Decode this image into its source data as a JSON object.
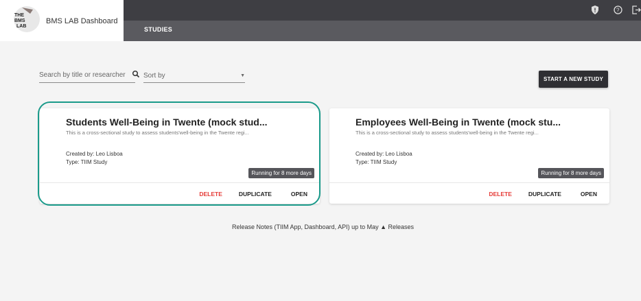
{
  "brand": {
    "title": "BMS LAB Dashboard",
    "logo_text": [
      "THE",
      "BMS",
      "LAB"
    ]
  },
  "nav": {
    "tab_studies": "STUDIES",
    "icons": [
      "shield-icon",
      "help-icon",
      "logout-icon"
    ]
  },
  "toolbar": {
    "search_placeholder": "Search by title or researcher",
    "sort_label": "Sort by",
    "start_button": "START A NEW STUDY"
  },
  "studies": [
    {
      "title": "Students Well-Being in Twente (mock stud...",
      "description": "This is a cross-sectional study to assess students'well-being in the Twente regi...",
      "created_by": "Created by: Leo Lisboa",
      "type": "Type: TIIM Study",
      "status": "Running for 8 more days",
      "actions": {
        "delete": "DELETE",
        "duplicate": "DUPLICATE",
        "open": "OPEN"
      }
    },
    {
      "title": "Employees Well-Being in Twente (mock stu...",
      "description": "This is a cross-sectional study to assess students'well-being in the Twente regi...",
      "created_by": "Created by: Leo Lisboa",
      "type": "Type: TIIM Study",
      "status": "Running for 8 more days",
      "actions": {
        "delete": "DELETE",
        "duplicate": "DUPLICATE",
        "open": "OPEN"
      }
    }
  ],
  "footer": {
    "release_notes": "Release Notes (TIIM App, Dashboard, API) up to May ▲ Releases"
  },
  "colors": {
    "highlight": "#1a9a8a",
    "delete": "#e53935",
    "navbar": "#5a5a5f"
  }
}
